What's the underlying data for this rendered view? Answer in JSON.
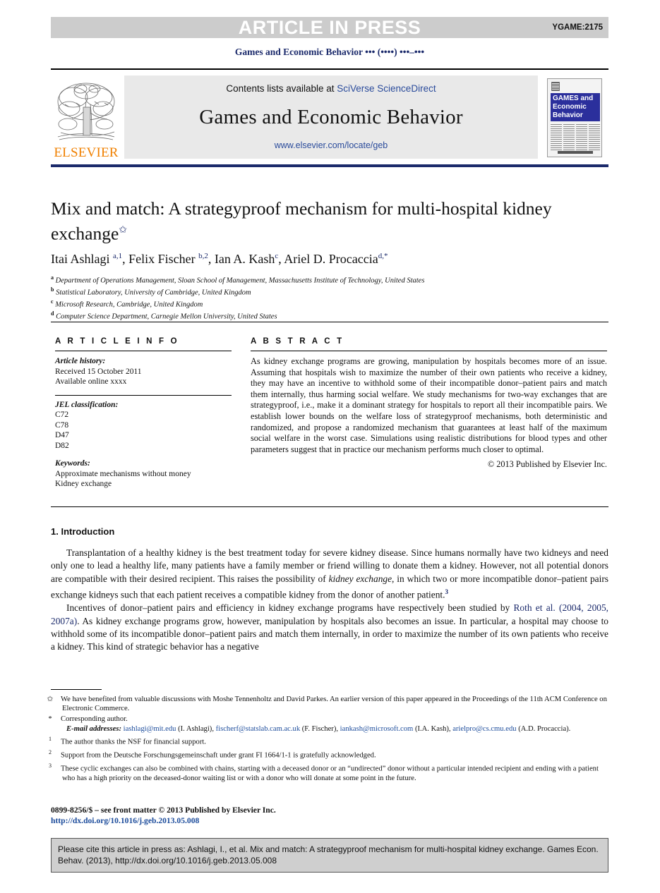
{
  "press_bar": {
    "label": "ARTICLE IN PRESS",
    "article_code": "YGAME:2175",
    "bg_color": "#cccccc",
    "text_color": "#ffffff"
  },
  "running_head": "Games and Economic Behavior ••• (••••) •••–•••",
  "masthead": {
    "contents_prefix": "Contents lists available at ",
    "contents_link": "SciVerse ScienceDirect",
    "journal_name": "Games and Economic Behavior",
    "journal_url": "www.elsevier.com/locate/geb",
    "publisher_wordmark": "ELSEVIER",
    "publisher_color": "#f08000",
    "link_color": "#2a4b9b",
    "cover": {
      "line1": "GAMES and",
      "line2": "Economic",
      "line3": "Behavior",
      "block_color": "#2b2f9c"
    }
  },
  "article": {
    "title": "Mix and match: A strategyproof mechanism for multi-hospital kidney exchange",
    "title_footnote_mark": "✩",
    "authors_html": "Itai Ashlagi <sup>a,1</sup>, Felix Fischer <sup>b,2</sup>, Ian A. Kash<sup>c</sup>, Ariel D. Procaccia<sup>d,*</sup>",
    "affiliations": [
      {
        "mark": "a",
        "text": "Department of Operations Management, Sloan School of Management, Massachusetts Institute of Technology, United States"
      },
      {
        "mark": "b",
        "text": "Statistical Laboratory, University of Cambridge, United Kingdom"
      },
      {
        "mark": "c",
        "text": "Microsoft Research, Cambridge, United Kingdom"
      },
      {
        "mark": "d",
        "text": "Computer Science Department, Carnegie Mellon University, United States"
      }
    ]
  },
  "article_info": {
    "heading": "A R T I C L E    I N F O",
    "history_label": "Article history:",
    "history_lines": [
      "Received 15 October 2011",
      "Available online xxxx"
    ],
    "jel_label": "JEL classification:",
    "jel_codes": [
      "C72",
      "C78",
      "D47",
      "D82"
    ],
    "keywords_label": "Keywords:",
    "keywords": [
      "Approximate mechanisms without money",
      "Kidney exchange"
    ]
  },
  "abstract": {
    "heading": "A B S T R A C T",
    "text": "As kidney exchange programs are growing, manipulation by hospitals becomes more of an issue. Assuming that hospitals wish to maximize the number of their own patients who receive a kidney, they may have an incentive to withhold some of their incompatible donor–patient pairs and match them internally, thus harming social welfare. We study mechanisms for two-way exchanges that are strategyproof, i.e., make it a dominant strategy for hospitals to report all their incompatible pairs. We establish lower bounds on the welfare loss of strategyproof mechanisms, both deterministic and randomized, and propose a randomized mechanism that guarantees at least half of the maximum social welfare in the worst case. Simulations using realistic distributions for blood types and other parameters suggest that in practice our mechanism performs much closer to optimal.",
    "copyright": "© 2013 Published by Elsevier Inc."
  },
  "body": {
    "section_heading": "1. Introduction",
    "paragraph1_html": "Transplantation of a healthy kidney is the best treatment today for severe kidney disease. Since humans normally have two kidneys and need only one to lead a healthy life, many patients have a family member or friend willing to donate them a kidney. However, not all potential donors are compatible with their desired recipient. This raises the possibility of <em>kidney exchange</em>, in which two or more incompatible donor–patient pairs exchange kidneys such that each patient receives a compatible kidney from the donor of another patient.<sup>3</sup>",
    "paragraph2_html": "Incentives of donor–patient pairs and efficiency in kidney exchange programs have respectively been studied by <a href=\"#\">Roth et al. (2004, 2005, 2007a)</a>. As kidney exchange programs grow, however, manipulation by hospitals also becomes an issue. In particular, a hospital may choose to withhold some of its incompatible donor–patient pairs and match them internally, in order to maximize the number of its own patients who receive a kidney. This kind of strategic behavior has a negative"
  },
  "footnotes": {
    "star_mark": "✩",
    "star_text": "We have benefited from valuable discussions with Moshe Tennenholtz and David Parkes. An earlier version of this paper appeared in the Proceedings of the 11th ACM Conference on Electronic Commerce.",
    "corresponding_mark": "*",
    "corresponding_text": "Corresponding author.",
    "email_label": "E-mail addresses:",
    "emails": [
      {
        "address": "iashlagi@mit.edu",
        "owner": "(I. Ashlagi)"
      },
      {
        "address": "fischerf@statslab.cam.ac.uk",
        "owner": "(F. Fischer)"
      },
      {
        "address": "iankash@microsoft.com",
        "owner": "(I.A. Kash)"
      },
      {
        "address": "arielpro@cs.cmu.edu",
        "owner": "(A.D. Procaccia)."
      }
    ],
    "numbered": [
      {
        "mark": "1",
        "text": "The author thanks the NSF for financial support."
      },
      {
        "mark": "2",
        "text": "Support from the Deutsche Forschungsgemeinschaft under grant FI 1664/1-1 is gratefully acknowledged."
      },
      {
        "mark": "3",
        "text": "These cyclic exchanges can also be combined with chains, starting with a deceased donor or an “undirected” donor without a particular intended recipient and ending with a patient who has a high priority on the deceased-donor waiting list or with a donor who will donate at some point in the future."
      }
    ]
  },
  "front_matter": {
    "issn_line": "0899-8256/$ – see front matter  © 2013 Published by Elsevier Inc.",
    "doi_link": "http://dx.doi.org/10.1016/j.geb.2013.05.008"
  },
  "citation_box": {
    "text": "Please cite this article in press as: Ashlagi, I., et al. Mix and match: A strategyproof mechanism for multi-hospital kidney exchange. Games Econ. Behav. (2013), http://dx.doi.org/10.1016/j.geb.2013.05.008",
    "bg_color": "#cfcfcf"
  }
}
